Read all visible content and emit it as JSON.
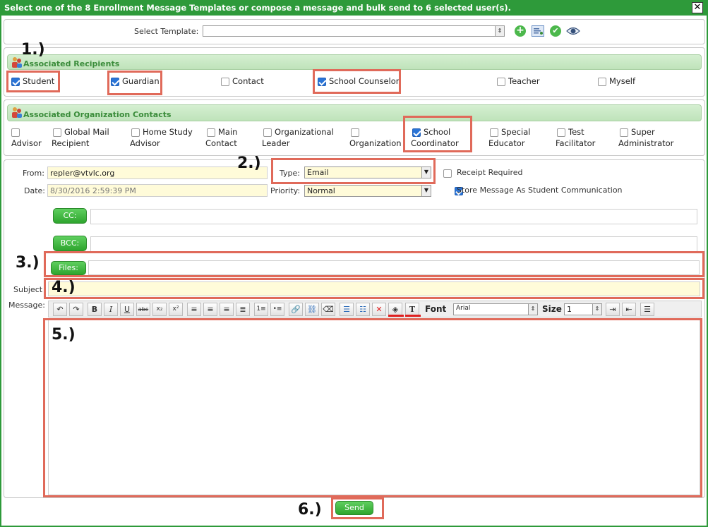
{
  "title": "Select one of the 8 Enrollment Message Templates or compose a message and bulk send to 6 selected user(s).",
  "close_glyph": "✕",
  "template": {
    "label": "Select Template:",
    "value": ""
  },
  "annotations": {
    "a1": "1.)",
    "a2": "2.)",
    "a3": "3.)",
    "a4": "4.)",
    "a5": "5.)",
    "a6": "6.)"
  },
  "recipients": {
    "header": "Associated Recipients",
    "items": [
      {
        "label": "Student",
        "checked": true
      },
      {
        "label": "Guardian",
        "checked": true
      },
      {
        "label": "Contact",
        "checked": false
      },
      {
        "label": "School Counselor",
        "checked": true
      },
      {
        "label": "Teacher",
        "checked": false
      },
      {
        "label": "Myself",
        "checked": false
      }
    ]
  },
  "org_contacts": {
    "header": "Associated Organization Contacts",
    "items": [
      {
        "line1": "",
        "line2": "Advisor",
        "checked": false
      },
      {
        "line1": "Global Mail",
        "line2": "Recipient",
        "checked": false
      },
      {
        "line1": "Home Study",
        "line2": "Advisor",
        "checked": false
      },
      {
        "line1": "Main",
        "line2": "Contact",
        "checked": false
      },
      {
        "line1": "Organizational",
        "line2": "Leader",
        "checked": false
      },
      {
        "line1": "",
        "line2": "Organization",
        "checked": false
      },
      {
        "line1": "School",
        "line2": "Coordinator",
        "checked": true
      },
      {
        "line1": "Special",
        "line2": "Educator",
        "checked": false
      },
      {
        "line1": "Test",
        "line2": "Facilitator",
        "checked": false
      },
      {
        "line1": "Super",
        "line2": "Administrator",
        "checked": false
      }
    ]
  },
  "compose": {
    "from_label": "From:",
    "from_value": "repler@vtvlc.org",
    "date_label": "Date:",
    "date_value": "8/30/2016 2:59:39 PM",
    "type_label": "Type:",
    "type_value": "Email",
    "priority_label": "Priority:",
    "priority_value": "Normal",
    "receipt_label": "Receipt Required",
    "receipt_checked": false,
    "store_label": "Store Message As Student Communication",
    "store_checked": true,
    "cc_label": "CC:",
    "bcc_label": "BCC:",
    "files_label": "Files:",
    "subject_label": "Subject",
    "message_label": "Message:"
  },
  "editor": {
    "font_label": "Font",
    "font_value": "Arial",
    "size_label": "Size",
    "size_value": "1",
    "underline_accent": "#e02020"
  },
  "send_label": "Send"
}
